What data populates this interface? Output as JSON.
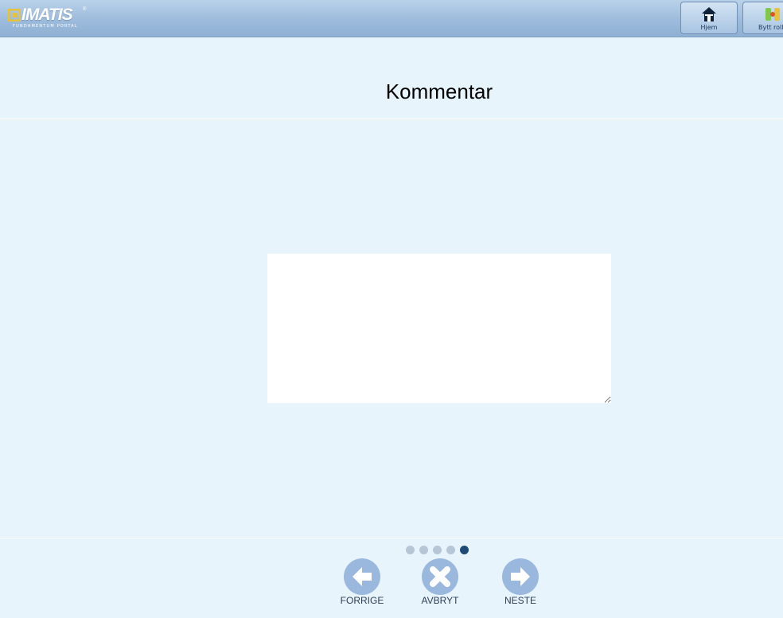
{
  "header": {
    "logo_text": "IMATIS",
    "logo_reg": "®",
    "logo_subtitle": "FUNDAMENTUM PORTAL",
    "nav": [
      {
        "label": "Hjem",
        "icon": "home-icon"
      },
      {
        "label": "Bytt roll",
        "icon": "switch-role-icon"
      }
    ]
  },
  "page": {
    "title": "Kommentar"
  },
  "comment": {
    "value": ""
  },
  "steps": {
    "total": 5,
    "current": 5
  },
  "actions": {
    "prev_label": "FORRIGE",
    "cancel_label": "AVBRYT",
    "next_label": "NESTE"
  },
  "colors": {
    "background": "#e8f4fc",
    "button_circle": "#9ab8de",
    "dot_inactive": "#b6c6d6",
    "dot_active": "#1f4a78"
  }
}
